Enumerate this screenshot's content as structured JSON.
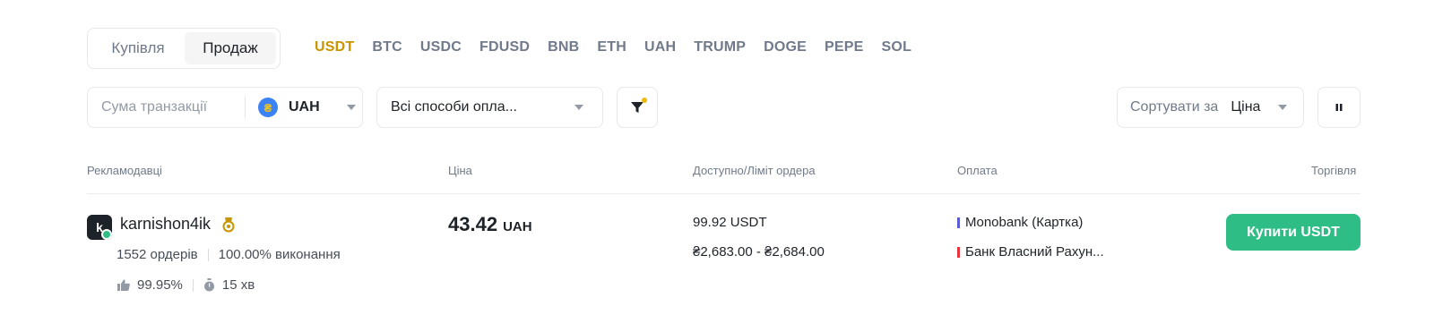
{
  "side_toggle": {
    "buy": "Купівля",
    "sell": "Продаж"
  },
  "coins": [
    "USDT",
    "BTC",
    "USDC",
    "FDUSD",
    "BNB",
    "ETH",
    "UAH",
    "TRUMP",
    "DOGE",
    "PEPE",
    "SOL"
  ],
  "active_coin": "USDT",
  "amount": {
    "placeholder": "Сума транзакції",
    "value": "",
    "currency": "UAH",
    "currency_symbol": "₴"
  },
  "payment_filter": {
    "label": "Всі способи опла..."
  },
  "sort": {
    "prefix": "Сортувати за",
    "value": "Ціна"
  },
  "table": {
    "headers": {
      "advertiser": "Рекламодавці",
      "price": "Ціна",
      "available": "Доступно/Ліміт ордера",
      "payment": "Оплата",
      "trade": "Торгівля"
    },
    "rows": [
      {
        "avatar_letter": "k",
        "merchant": "karnishon4ik",
        "orders": "1552 ордерів",
        "completion": "100.00% виконання",
        "positive_rate": "99.95%",
        "pay_time": "15 хв",
        "price": "43.42",
        "price_unit": "UAH",
        "available": "99.92 USDT",
        "limit": "₴2,683.00 - ₴2,684.00",
        "payments": [
          {
            "name": "Monobank (Картка)",
            "color": "#5b5bd6"
          },
          {
            "name": "Банк Власний Рахун...",
            "color": "#e8343d"
          }
        ],
        "action": "Купити USDT"
      }
    ]
  },
  "colors": {
    "accent": "#c99400",
    "buy_green": "#2ebd85",
    "online": "#2ebd85"
  },
  "icons": {
    "filter": "filter-icon",
    "pause": "pause-icon",
    "badge": "merchant-badge-icon",
    "like": "thumbs-up-icon",
    "timer": "timer-icon"
  }
}
